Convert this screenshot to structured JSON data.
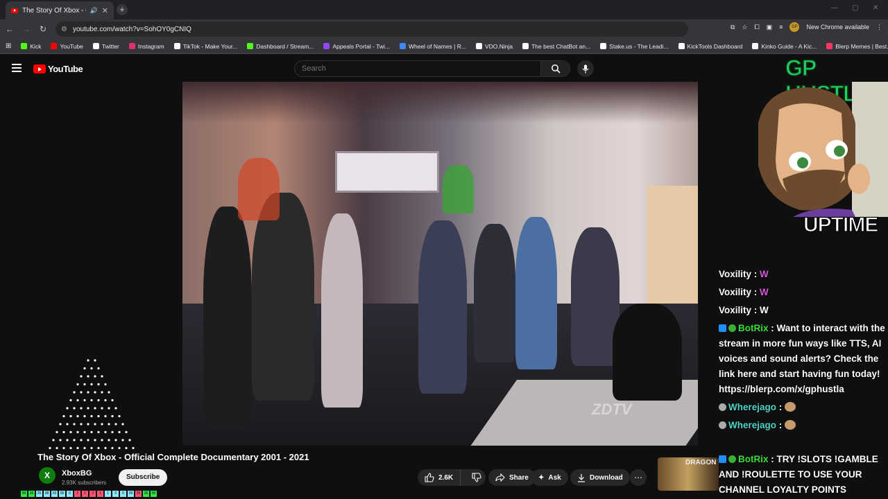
{
  "browser": {
    "tab_title": "The Story Of Xbox - Official",
    "tab_close": "✕",
    "new_tab": "+",
    "url": "youtube.com/watch?v=SohOY0gCNIQ",
    "chrome_available": "New Chrome available",
    "profile_initials": "GP"
  },
  "bookmarks": [
    {
      "label": "Kick",
      "color": "#53fc18"
    },
    {
      "label": "YouTube",
      "color": "#ff0000"
    },
    {
      "label": "Twitter",
      "color": "#ffffff"
    },
    {
      "label": "Instagram",
      "color": "#e1306c"
    },
    {
      "label": "TikTok - Make Your...",
      "color": "#ffffff"
    },
    {
      "label": "Dashboard / Stream...",
      "color": "#53fc18"
    },
    {
      "label": "Appeals Portal - Twi...",
      "color": "#9146ff"
    },
    {
      "label": "Wheel of Names | R...",
      "color": "#4285f4"
    },
    {
      "label": "VDO.Ninja",
      "color": "#ffffff"
    },
    {
      "label": "The best ChatBot an...",
      "color": "#ffffff"
    },
    {
      "label": "Stake.us - The Leadi...",
      "color": "#ffffff"
    },
    {
      "label": "KickTools Dashboard",
      "color": "#ffffff"
    },
    {
      "label": "Kinko Guide - A Kic...",
      "color": "#ffffff"
    },
    {
      "label": "Blerp Memes | Best...",
      "color": "#ff3366"
    }
  ],
  "youtube": {
    "logo_text": "YouTube",
    "search_placeholder": "Search"
  },
  "video": {
    "title": "The Story Of Xbox - Official Complete Documentary 2001 - 2021",
    "watermark": "ZDTV",
    "channel_initial": "X",
    "channel_name": "XboxBG",
    "subscribers": "2.93K subscribers",
    "subscribe_label": "Subscribe",
    "likes": "2.6K",
    "share_label": "Share",
    "ask_label": "Ask",
    "download_label": "Download",
    "more_label": "⋯"
  },
  "overlay": {
    "channel_title": "GP HUSTLA",
    "uptime_label": "UPTIME"
  },
  "chat": [
    {
      "user": "Voxility",
      "message": "W",
      "type": "emote"
    },
    {
      "user": "Voxility",
      "message": "W",
      "type": "emote"
    },
    {
      "user": "Voxility",
      "message": "W",
      "type": "text"
    },
    {
      "user": "BotRix",
      "message": "Want to interact with the stream in more fun ways like TTS, AI voices and sound alerts? Check the link here and start having fun today! https://blerp.com/x/gphustla",
      "type": "bot"
    },
    {
      "user": "Wherejago",
      "message": "",
      "type": "monkey"
    },
    {
      "user": "Wherejago",
      "message": "",
      "type": "monkey"
    }
  ],
  "chat_bottom": {
    "user": "BotRix",
    "message": "TRY !SLOTS !GAMBLE AND !ROULETTE TO USE YOUR CHANNEL LOYALTY POINTS"
  },
  "suggested": {
    "thumb_text": "DRAGON"
  },
  "ticker": [
    "50",
    "36",
    "25",
    "08",
    "03",
    "05",
    "0",
    "3",
    "1",
    "-2",
    "1",
    "1",
    "3",
    "0",
    "09",
    "25",
    "36",
    "50"
  ]
}
